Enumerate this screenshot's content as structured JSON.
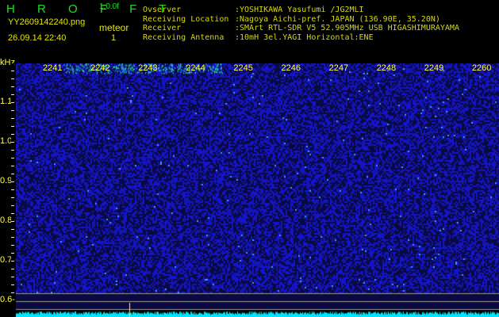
{
  "header": {
    "app_title": "H R O F F T",
    "version": "1.0.0f",
    "filename": "YY2609142240.png",
    "datetime": "26.09.14 22:40",
    "meteor_label": "meteor",
    "meteor_count": "1"
  },
  "info": [
    {
      "label": "Ovserver",
      "value": ":YOSHIKAWA Yasufumi /JG2MLI"
    },
    {
      "label": "Receiving Location",
      "value": ":Nagoya Aichi-pref. JAPAN (136.90E, 35.20N)"
    },
    {
      "label": "Receiver",
      "value": ":SMArt RTL-SDR V5 52.905MHz USB HIGASHIMURAYAMA"
    },
    {
      "label": "Receiving Antenna",
      "value": ":10mH 3el.YAGI Horizontal:ENE"
    }
  ],
  "axis": {
    "y_unit": "kHz",
    "y_ticks": [
      "1.1",
      "1.0",
      "0.9",
      "0.8",
      "0.7",
      "0.6"
    ],
    "x_ticks": [
      "2241",
      "2242",
      "2243",
      "2244",
      "2245",
      "2246",
      "2247",
      "2248",
      "2249",
      "2260"
    ]
  },
  "colors": {
    "text": "#e6e600",
    "title": "#22dd22",
    "spectrum": "#00e5ff",
    "noise": "#1a1a9a"
  }
}
